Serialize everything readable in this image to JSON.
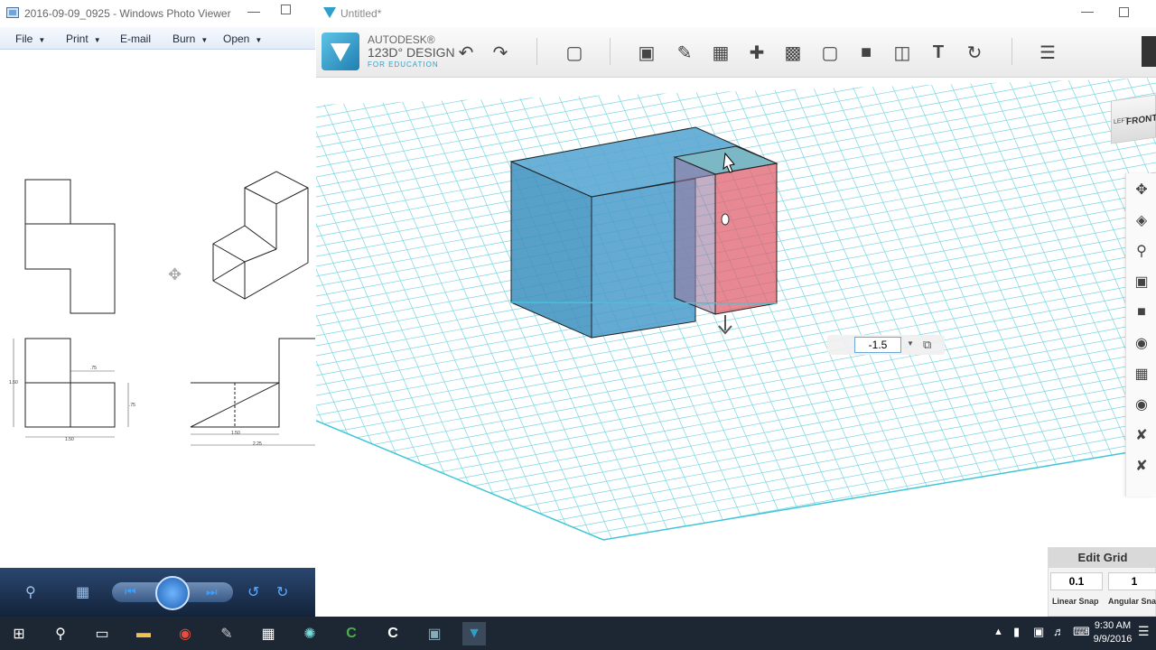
{
  "photo_viewer": {
    "title": "2016-09-09_0925 - Windows Photo Viewer",
    "menu": [
      {
        "label": "File"
      },
      {
        "label": "Print"
      },
      {
        "label": "E-mail"
      },
      {
        "label": "Burn"
      },
      {
        "label": "Open"
      }
    ],
    "drawing": {
      "dim_1": "1.50",
      "dim_2": ".75",
      "dim_3": ".75",
      "dim_4": "1.50",
      "dim_5": "1.50",
      "dim_6": "2.25"
    }
  },
  "app": {
    "title": "Untitled*",
    "brand_line1": "AUTODESK®",
    "brand_line2": "123D° DESIGN",
    "brand_line3": "FOR EDUCATION",
    "viewcube_left": "LEFT",
    "viewcube_front": "FRONT",
    "extrude_value": "-1.5",
    "edit_grid": {
      "title": "Edit Grid",
      "linear_value": "0.1",
      "angular_value": "1",
      "linear_label": "Linear Snap",
      "angular_label": "Angular Snap"
    }
  },
  "taskbar": {
    "time": "9:30 AM",
    "date": "9/9/2016"
  },
  "colors": {
    "accent": "#2e9fc8",
    "box_blue": "#3c8fc0",
    "box_red": "#e0606e",
    "grid": "#6fd0dc"
  }
}
